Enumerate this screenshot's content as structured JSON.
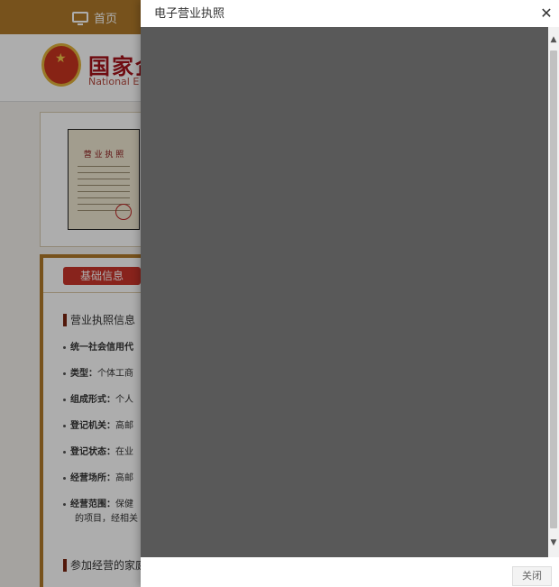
{
  "nav": {
    "home_label": "首页"
  },
  "header": {
    "title": "国家企",
    "subtitle": "National E"
  },
  "license_card": {
    "thumb_title": "营 业 执 照"
  },
  "info": {
    "tab_label": "基础信息",
    "section1": "营业执照信息",
    "fields": [
      {
        "label": "统一社会信用代",
        "value": ""
      },
      {
        "label": "类型：",
        "value": "个体工商"
      },
      {
        "label": "组成形式：",
        "value": "个人"
      },
      {
        "label": "登记机关：",
        "value": "高邮"
      },
      {
        "label": "登记状态：",
        "value": "在业"
      },
      {
        "label": "经营场所：",
        "value": "高邮"
      },
      {
        "label": "经营范围：",
        "value": "保健"
      }
    ],
    "extra_line": "的项目，经相关",
    "section2": "参加经营的家庭"
  },
  "modal": {
    "title": "电子营业执照",
    "close_icon": "close-icon",
    "close_button": "关闭"
  },
  "colors": {
    "brand": "#b07a2a",
    "accent": "#c9342a",
    "overlay": "rgba(0,0,0,0.32)",
    "viewer_bg": "#595959"
  }
}
